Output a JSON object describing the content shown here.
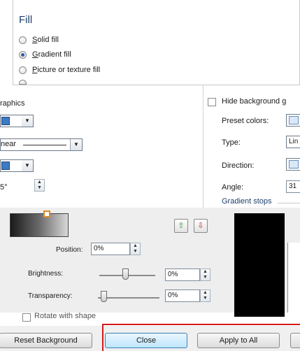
{
  "fill_panel": {
    "title": "Fill",
    "options": [
      {
        "label": "Solid fill",
        "hotkey": "S",
        "rest": "olid fill",
        "selected": false
      },
      {
        "label": "Gradient fill",
        "hotkey": "G",
        "rest": "radient fill",
        "selected": true
      },
      {
        "label": "Picture or texture fill",
        "hotkey": "P",
        "rest": "icture or texture fill",
        "selected": false
      }
    ]
  },
  "left_panel": {
    "header": "raphics",
    "type_value": "near",
    "angle_value": "5°"
  },
  "right_panel": {
    "hide_bg_label": "Hide background g",
    "preset_colors_label": "Preset colors:",
    "type_label": "Type:",
    "type_value": "Lin",
    "direction_label": "Direction:",
    "angle_label": "Angle:",
    "angle_value": "31",
    "gradient_stops_label": "Gradient stops"
  },
  "stops": {
    "position_label": "Position:",
    "position_value": "0%",
    "brightness_label": "Brightness:",
    "brightness_value": "0%",
    "brightness_level": 0.55,
    "transparency_label": "Transparency:",
    "transparency_value": "0%",
    "transparency_level": 0.12,
    "rotate_label": "Rotate with shape",
    "add_icon": "add-stop-icon",
    "remove_icon": "remove-stop-icon"
  },
  "buttons": {
    "reset": "Reset Background",
    "close": "Close",
    "apply_all": "Apply to All"
  },
  "colors": {
    "accent_blue": "#3c7ac4",
    "highlight_red": "#d21a1a",
    "selected_radio": "#2b5ea8"
  }
}
